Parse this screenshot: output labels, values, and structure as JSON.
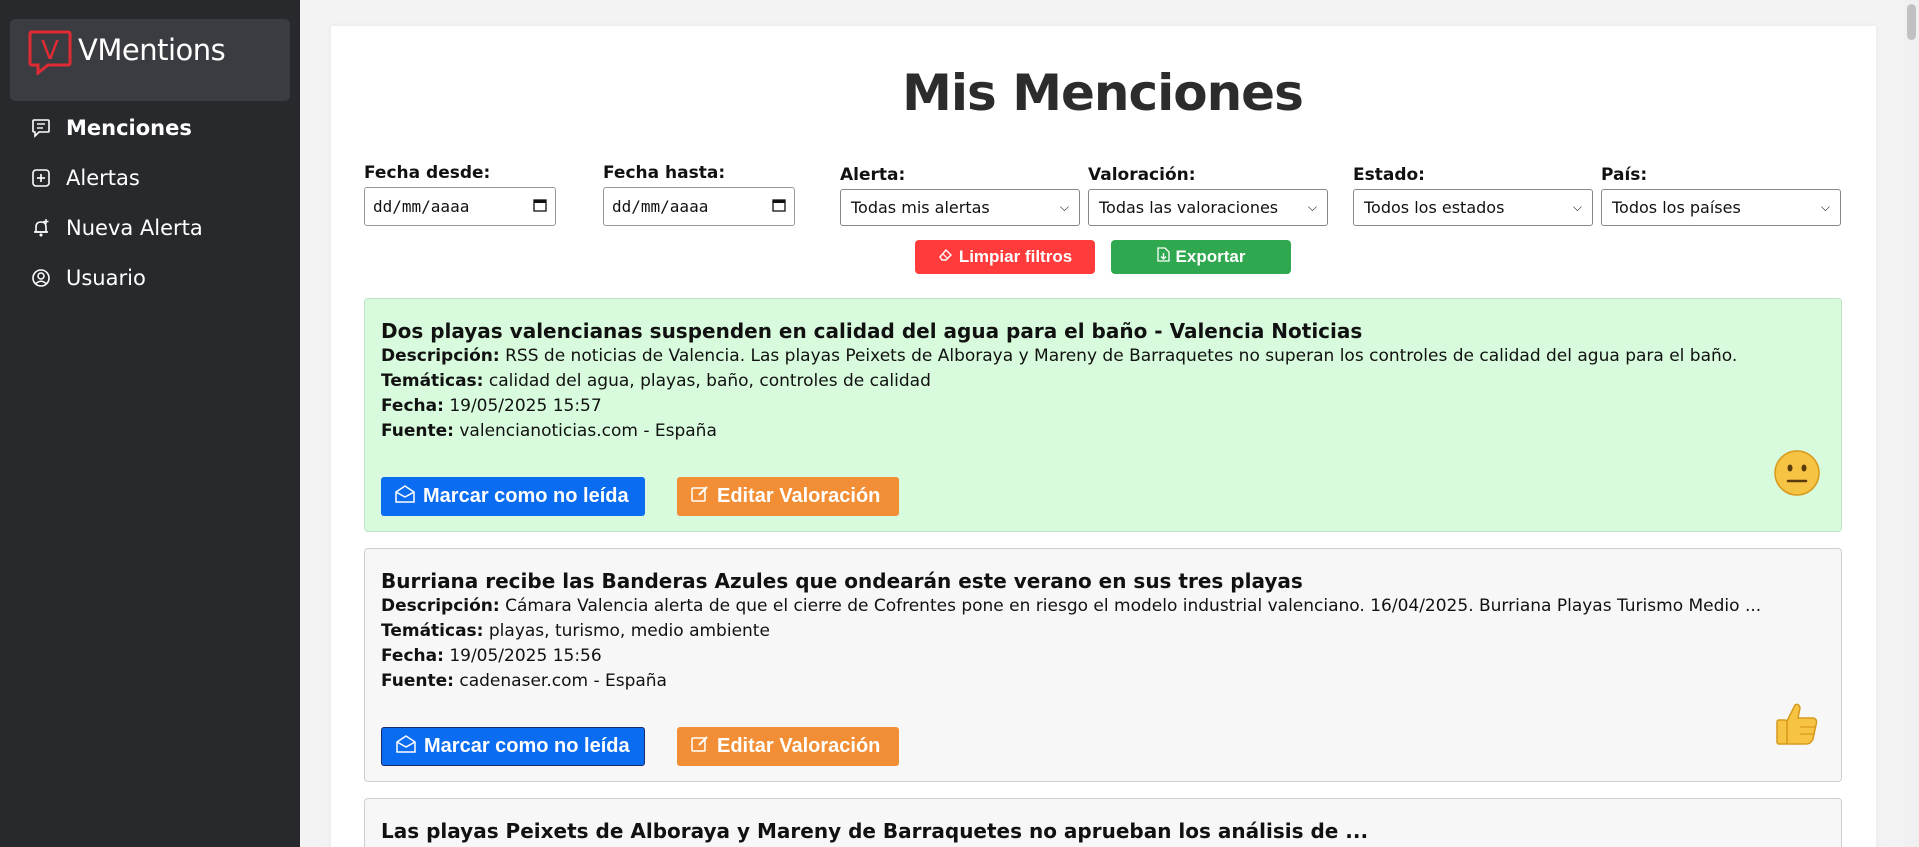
{
  "brand": {
    "name": "VMentions",
    "logo_letter": "V",
    "logo_color": "#e02b34"
  },
  "sidebar": {
    "items": [
      {
        "label": "Menciones",
        "icon": "comment-icon",
        "active": true
      },
      {
        "label": "Alertas",
        "icon": "plus-square-icon",
        "active": false
      },
      {
        "label": "Nueva Alerta",
        "icon": "bell-plus-icon",
        "active": false
      },
      {
        "label": "Usuario",
        "icon": "user-circle-icon",
        "active": false
      }
    ]
  },
  "page": {
    "title": "Mis Menciones"
  },
  "filters": {
    "date_from": {
      "label": "Fecha desde:",
      "value": "dd/mm/aaaa"
    },
    "date_to": {
      "label": "Fecha hasta:",
      "value": "dd/mm/aaaa"
    },
    "alert": {
      "label": "Alerta:",
      "value": "Todas mis alertas"
    },
    "rating": {
      "label": "Valoración:",
      "value": "Todas las valoraciones"
    },
    "status": {
      "label": "Estado:",
      "value": "Todos los estados"
    },
    "country": {
      "label": "País:",
      "value": "Todos los países"
    }
  },
  "actions": {
    "clear_label": "Limpiar filtros",
    "export_label": "Exportar",
    "clear_color": "#ff3b3b",
    "export_color": "#2fa84f"
  },
  "field_labels": {
    "description": "Descripción:",
    "topics": "Temáticas:",
    "date": "Fecha:",
    "source": "Fuente:"
  },
  "mentions": [
    {
      "title": "Dos playas valencianas suspenden en calidad del agua para el baño - Valencia Noticias",
      "description": "RSS de noticias de Valencia. Las playas Peixets de Alboraya y Mareny de Barraquetes no superan los controles de calidad del agua para el baño.",
      "topics": "calidad del agua, playas, baño, controles de calidad",
      "date": "19/05/2025 15:57",
      "source": "valencianoticias.com - España",
      "mark_label": "Marcar como no leída",
      "edit_label": "Editar Valoración",
      "rating_icon": "neutral-face-icon",
      "background": "#d7fbdc"
    },
    {
      "title": "Burriana recibe las Banderas Azules que ondearán este verano en sus tres playas",
      "description": "Cámara Valencia alerta de que el cierre de Cofrentes pone en riesgo el modelo industrial valenciano. 16/04/2025. Burriana Playas Turismo Medio ...",
      "topics": "playas, turismo, medio ambiente",
      "date": "19/05/2025 15:56",
      "source": "cadenaser.com - España",
      "mark_label": "Marcar como no leída",
      "edit_label": "Editar Valoración",
      "rating_icon": "thumbs-up-icon",
      "background": "#f7f7f7"
    },
    {
      "title": "Las playas Peixets de Alboraya y Mareny de Barraquetes no aprueban los análisis de ..."
    }
  ]
}
